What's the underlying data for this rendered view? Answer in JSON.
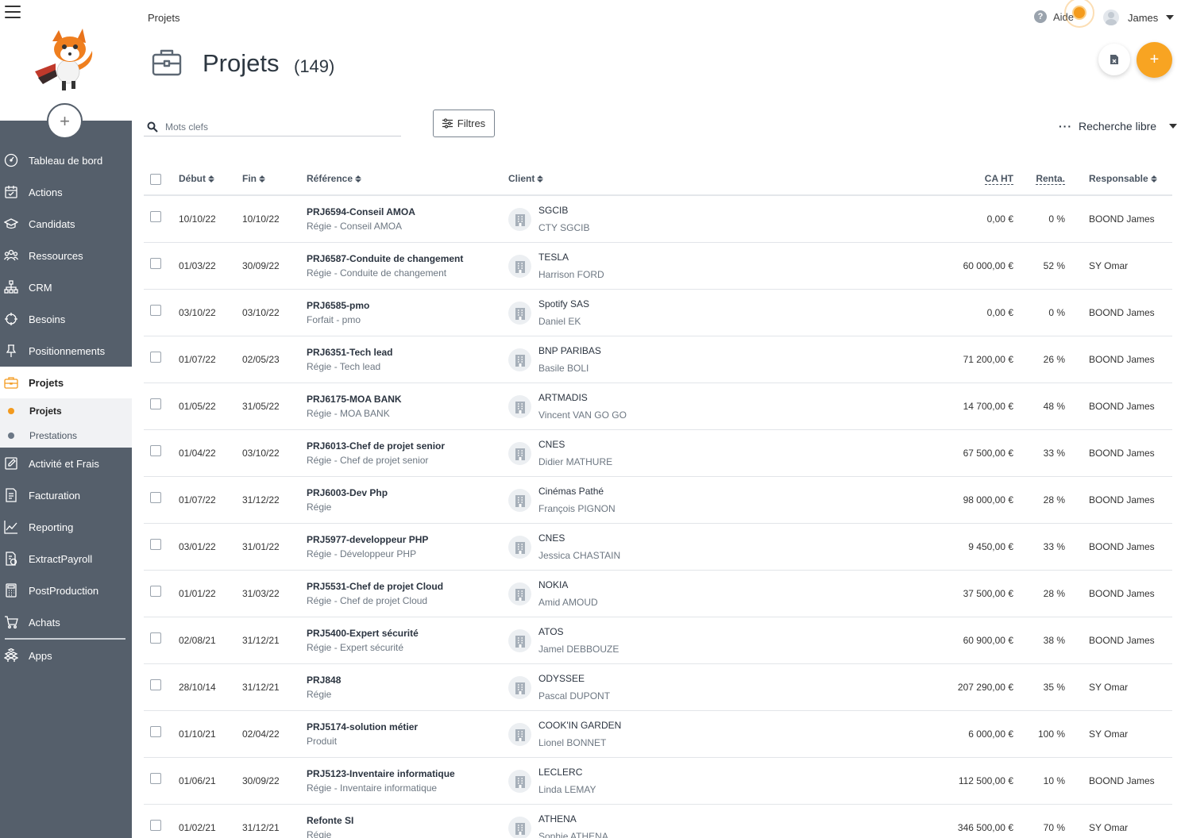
{
  "breadcrumb": "Projets",
  "header": {
    "help_label": "Aide",
    "help_glyph": "?",
    "user_name": "James"
  },
  "page": {
    "title": "Projets",
    "count": "(149)"
  },
  "toolbar": {
    "search_placeholder": "Mots clefs",
    "filters_label": "Filtres",
    "free_search_label": "Recherche libre",
    "free_search_dots": "···",
    "add_glyph": "+"
  },
  "sidebar": {
    "add_glyph": "+",
    "items": [
      {
        "label": "Tableau de bord",
        "icon": "dashboard-icon"
      },
      {
        "label": "Actions",
        "icon": "actions-icon"
      },
      {
        "label": "Candidats",
        "icon": "graduation-cap-icon"
      },
      {
        "label": "Ressources",
        "icon": "people-icon"
      },
      {
        "label": "CRM",
        "icon": "org-chart-icon"
      },
      {
        "label": "Besoins",
        "icon": "target-icon"
      },
      {
        "label": "Positionnements",
        "icon": "pin-icon"
      },
      {
        "label": "Projets",
        "icon": "briefcase-icon",
        "active": true
      }
    ],
    "subitems": [
      {
        "label": "Projets",
        "active": true
      },
      {
        "label": "Prestations"
      }
    ],
    "items_after": [
      {
        "label": "Activité et Frais",
        "icon": "edit-icon"
      },
      {
        "label": "Facturation",
        "icon": "invoice-icon"
      },
      {
        "label": "Reporting",
        "icon": "chart-line-icon"
      },
      {
        "label": "ExtractPayroll",
        "icon": "payroll-icon"
      },
      {
        "label": "PostProduction",
        "icon": "calculator-icon"
      },
      {
        "label": "Achats",
        "icon": "cart-icon"
      }
    ],
    "apps": {
      "label": "Apps",
      "icon": "apps-icon"
    }
  },
  "table": {
    "columns": {
      "debut": "Début",
      "fin": "Fin",
      "reference": "Référence",
      "client": "Client",
      "ca": "CA HT",
      "renta": "Renta.",
      "responsable": "Responsable"
    },
    "rows": [
      {
        "debut": "10/10/22",
        "fin": "10/10/22",
        "ref": "PRJ6594-Conseil AMOA",
        "type": "Régie  - Conseil AMOA",
        "client": "SGCIB",
        "contact": "CTY SGCIB",
        "ca": "0,00 €",
        "renta": "0 %",
        "resp": "BOOND James"
      },
      {
        "debut": "01/03/22",
        "fin": "30/09/22",
        "ref": "PRJ6587-Conduite de changement",
        "type": "Régie  - Conduite de changement",
        "client": "TESLA",
        "contact": "Harrison FORD",
        "ca": "60 000,00 €",
        "renta": "52 %",
        "resp": "SY Omar"
      },
      {
        "debut": "03/10/22",
        "fin": "03/10/22",
        "ref": "PRJ6585-pmo",
        "type": "Forfait  - pmo",
        "client": "Spotify SAS",
        "contact": "Daniel EK",
        "ca": "0,00 €",
        "renta": "0 %",
        "resp": "BOOND James"
      },
      {
        "debut": "01/07/22",
        "fin": "02/05/23",
        "ref": "PRJ6351-Tech lead",
        "type": "Régie  - Tech lead",
        "client": "BNP PARIBAS",
        "contact": "Basile BOLI",
        "ca": "71 200,00 €",
        "renta": "26 %",
        "resp": "BOOND James"
      },
      {
        "debut": "01/05/22",
        "fin": "31/05/22",
        "ref": "PRJ6175-MOA BANK",
        "type": "Régie  - MOA BANK",
        "client": "ARTMADIS",
        "contact": "Vincent VAN GO GO",
        "ca": "14 700,00 €",
        "renta": "48 %",
        "resp": "BOOND James"
      },
      {
        "debut": "01/04/22",
        "fin": "03/10/22",
        "ref": "PRJ6013-Chef de projet senior",
        "type": "Régie  - Chef de projet senior",
        "client": "CNES",
        "contact": "Didier MATHURE",
        "ca": "67 500,00 €",
        "renta": "33 %",
        "resp": "BOOND James"
      },
      {
        "debut": "01/07/22",
        "fin": "31/12/22",
        "ref": "PRJ6003-Dev Php",
        "type": "Régie",
        "client": "Cinémas Pathé",
        "contact": "François PIGNON",
        "ca": "98 000,00 €",
        "renta": "28 %",
        "resp": "BOOND James"
      },
      {
        "debut": "03/01/22",
        "fin": "31/01/22",
        "ref": "PRJ5977-developpeur PHP",
        "type": "Régie  - Développeur PHP",
        "client": "CNES",
        "contact": "Jessica CHASTAIN",
        "ca": "9 450,00 €",
        "renta": "33 %",
        "resp": "BOOND James"
      },
      {
        "debut": "01/01/22",
        "fin": "31/03/22",
        "ref": "PRJ5531-Chef de projet Cloud",
        "type": "Régie  - Chef de projet Cloud",
        "client": "NOKIA",
        "contact": "Amid AMOUD",
        "ca": "37 500,00 €",
        "renta": "28 %",
        "resp": "BOOND James"
      },
      {
        "debut": "02/08/21",
        "fin": "31/12/21",
        "ref": "PRJ5400-Expert sécurité",
        "type": "Régie  - Expert sécurité",
        "client": "ATOS",
        "contact": "Jamel DEBBOUZE",
        "ca": "60 900,00 €",
        "renta": "38 %",
        "resp": "BOOND James"
      },
      {
        "debut": "28/10/14",
        "fin": "31/12/21",
        "ref": "PRJ848",
        "type": "Régie",
        "client": "ODYSSEE",
        "contact": "Pascal DUPONT",
        "ca": "207 290,00 €",
        "renta": "35 %",
        "resp": "SY Omar"
      },
      {
        "debut": "01/10/21",
        "fin": "02/04/22",
        "ref": "PRJ5174-solution métier",
        "type": "Produit",
        "client": "COOK'IN GARDEN",
        "contact": "Lionel BONNET",
        "ca": "6 000,00 €",
        "renta": "100 %",
        "resp": "SY Omar"
      },
      {
        "debut": "01/06/21",
        "fin": "30/09/22",
        "ref": "PRJ5123-Inventaire informatique",
        "type": "Régie  - Inventaire informatique",
        "client": "LECLERC",
        "contact": "Linda LEMAY",
        "ca": "112 500,00 €",
        "renta": "10 %",
        "resp": "BOOND James"
      },
      {
        "debut": "01/02/21",
        "fin": "31/12/21",
        "ref": "Refonte SI",
        "type": "Régie",
        "client": "ATHENA",
        "contact": "Sophie ATHENA",
        "ca": "346 500,00 €",
        "renta": "70 %",
        "resp": "SY Omar"
      }
    ]
  },
  "colors": {
    "sidebar_bg": "#555f6b",
    "accent": "#f8a422",
    "active_dot": "#f39a1e"
  }
}
